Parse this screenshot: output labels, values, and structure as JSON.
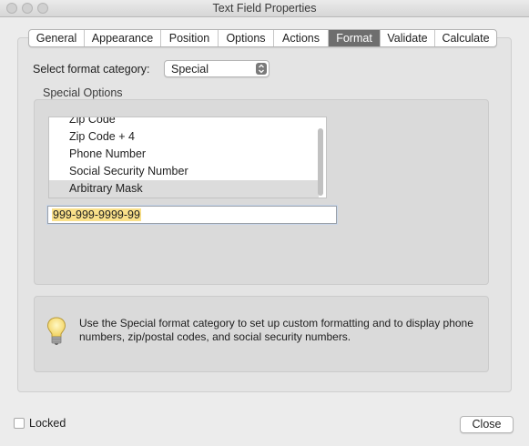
{
  "window": {
    "title": "Text Field Properties"
  },
  "tabs": [
    {
      "label": "General"
    },
    {
      "label": "Appearance"
    },
    {
      "label": "Position"
    },
    {
      "label": "Options"
    },
    {
      "label": "Actions"
    },
    {
      "label": "Format",
      "active": true
    },
    {
      "label": "Validate"
    },
    {
      "label": "Calculate"
    }
  ],
  "format": {
    "category_label": "Select format category:",
    "category_value": "Special"
  },
  "special_options": {
    "group_label": "Special Options",
    "items": [
      {
        "label": "Zip Code"
      },
      {
        "label": "Zip Code + 4"
      },
      {
        "label": "Phone Number"
      },
      {
        "label": "Social Security Number"
      },
      {
        "label": "Arbitrary Mask",
        "selected": true
      }
    ],
    "mask_value": "999-999-9999-99"
  },
  "info": {
    "icon": "lightbulb-icon",
    "text": "Use the Special format category to set up custom formatting and to display phone numbers, zip/postal codes, and social security numbers."
  },
  "footer": {
    "locked_label": "Locked",
    "locked_checked": false,
    "close_label": "Close"
  }
}
